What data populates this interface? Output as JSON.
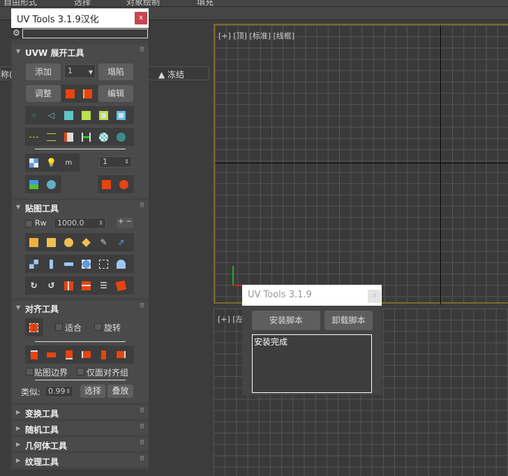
{
  "top_menu": [
    "自由形式",
    "选择",
    "对象绘制",
    "填充"
  ],
  "viewport_top": {
    "labels": [
      "[+]",
      "[顶]",
      "[标准]",
      "[线框]"
    ]
  },
  "viewport_bottom": {
    "labels": [
      "[+]",
      "[左"
    ]
  },
  "background_panel": {
    "column_left": "称(按",
    "column_freeze": "冻结"
  },
  "uv_tools_window": {
    "title": "UV Tools 3.1.9汉化",
    "close": "x",
    "unwrap": {
      "title": "UVW 展开工具",
      "add": "添加",
      "channel": "1",
      "collapse": "塌陷",
      "adjust": "调整",
      "edit": "编辑",
      "spinner": "1"
    },
    "mapping": {
      "title": "贴图工具",
      "rw_label": "Rw",
      "rw_value": "1000.0",
      "plus": "+",
      "minus": "−"
    },
    "align": {
      "title": "对齐工具",
      "fit": "适合",
      "rotate": "旋转",
      "map_border": "贴图边界",
      "face_group_only": "仅面对齐组",
      "similar_label": "类似:",
      "similar_value": "0.99",
      "select": "选择",
      "stack": "叠放"
    },
    "collapsed": [
      "变换工具",
      "随机工具",
      "几何体工具",
      "纹理工具"
    ]
  },
  "installer_dialog": {
    "title": "UV Tools 3.1.9",
    "close": "x",
    "install": "安装脚本",
    "uninstall": "卸载脚本",
    "output": "安装完成"
  },
  "colors": {
    "accent_orange": "#e8440f",
    "cyan": "#5fc4c4",
    "lime": "#a8e040",
    "viewport_border": "#7a6a2a"
  }
}
